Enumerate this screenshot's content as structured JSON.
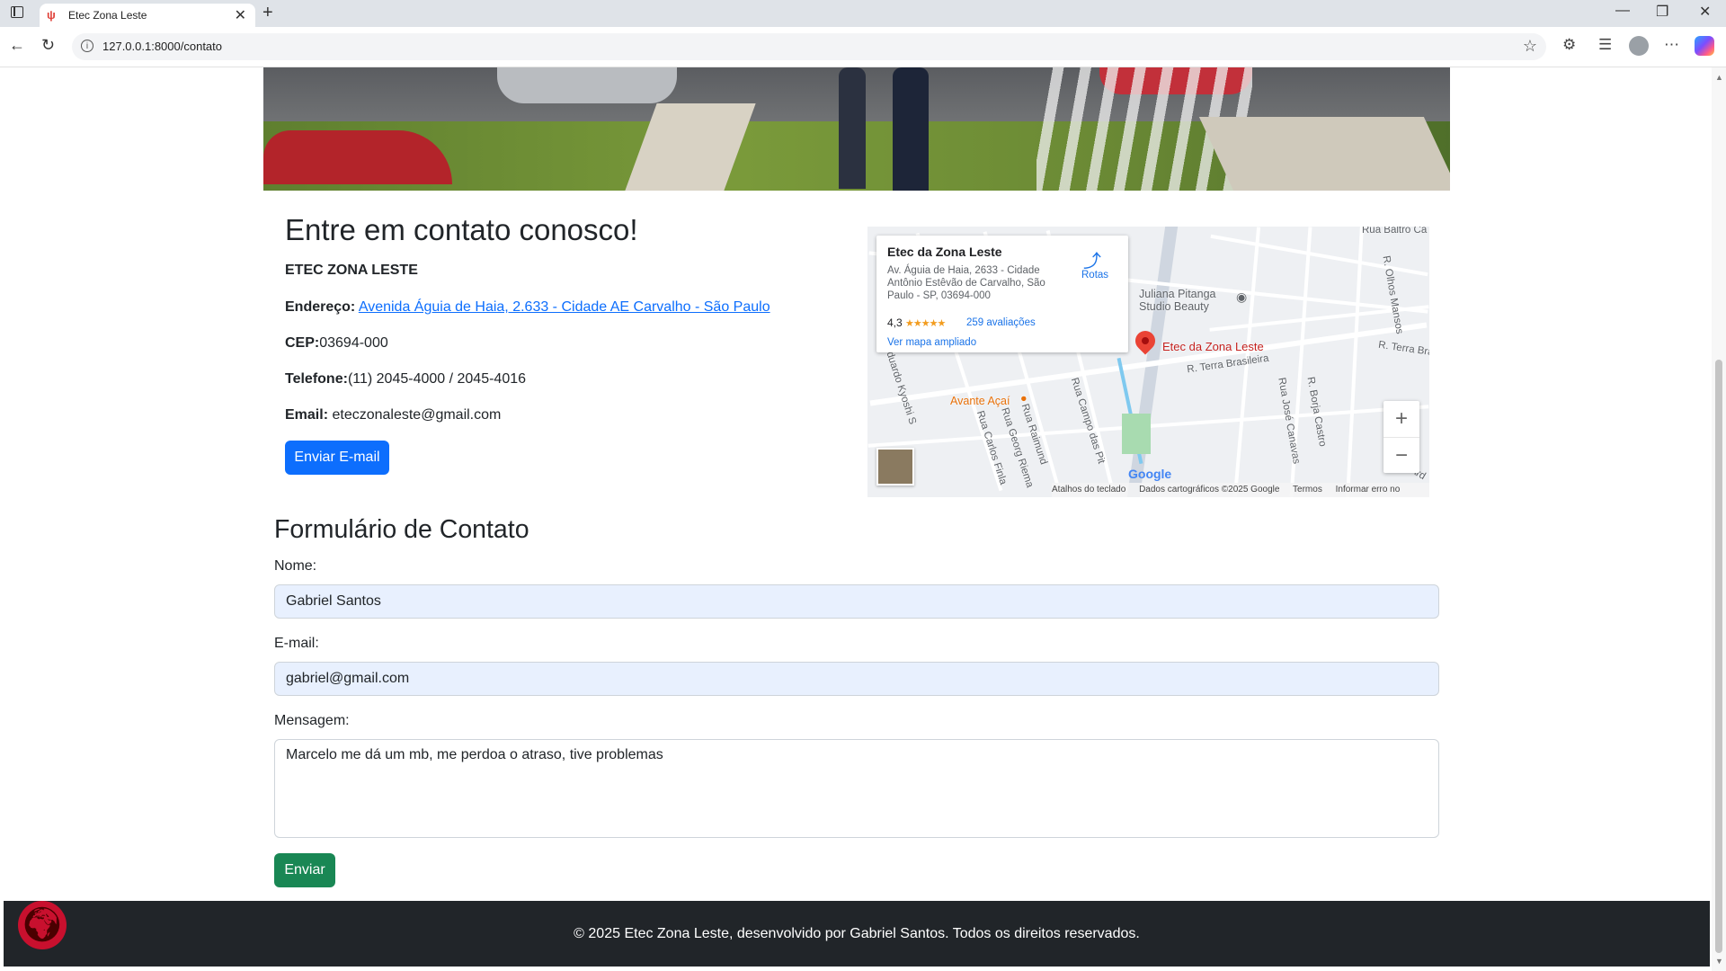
{
  "browser": {
    "tab_title": "Etec Zona Leste",
    "url": "127.0.0.1:8000/contato"
  },
  "contact": {
    "title": "Entre em contato conosco!",
    "school_name": "ETEC ZONA LESTE",
    "address_label": "Endereço:",
    "address_link": "Avenida Águia de Haia, 2.633 - Cidade AE Carvalho - São Paulo",
    "cep_label": "CEP:",
    "cep_value": "03694-000",
    "phone_label": "Telefone:",
    "phone_value": "(11) 2045-4000 / 2045-4016",
    "email_label": "Email:",
    "email_value": "eteczonaleste@gmail.com",
    "email_button": "Enviar E-mail"
  },
  "map": {
    "place_name": "Etec da Zona Leste",
    "place_address": "Av. Águia de Haia, 2633 - Cidade Antônio Estêvão de Carvalho, São Paulo - SP, 03694-000",
    "rating": "4,3",
    "stars": "★★★★★",
    "reviews": "259 avaliações",
    "bigger_map": "Ver mapa ampliado",
    "directions": "Rotas",
    "pin_label": "Etec da Zona Leste",
    "poi_salon": "Juliana Pitanga Studio Beauty",
    "poi_food": "Avante Açaí",
    "streets": [
      "R. Terra Brasileira",
      "R. Terra Bra",
      "Rua Carlos Finla",
      "Rua Georg Riema",
      "Rua Raimund",
      "Rua Campo das Pit",
      "Eduardo Kyoshi S",
      "R. Olhos Mansos",
      "Rua José Canavas",
      "R. Borja Castro",
      "Rua Baltro Ca",
      "R. Ard"
    ],
    "google_mark": "Google",
    "footer_shortcuts": "Atalhos do teclado",
    "footer_data": "Dados cartográficos ©2025 Google",
    "footer_terms": "Termos",
    "footer_report": "Informar erro no mapa",
    "zoom_in": "+",
    "zoom_out": "−"
  },
  "form": {
    "title": "Formulário de Contato",
    "name_label": "Nome:",
    "name_value": "Gabriel Santos",
    "email_label": "E-mail:",
    "email_value": "gabriel@gmail.com",
    "message_label": "Mensagem:",
    "message_value": "Marcelo me dá um mb, me perdoa o atraso, tive problemas",
    "submit": "Enviar"
  },
  "footer": {
    "text": "© 2025 Etec Zona Leste, desenvolvido por Gabriel Santos. Todos os direitos reservados."
  },
  "colors": {
    "primary": "#0d6efd",
    "success": "#198754",
    "footer_bg": "#212529",
    "logo_red": "#c8102e"
  }
}
